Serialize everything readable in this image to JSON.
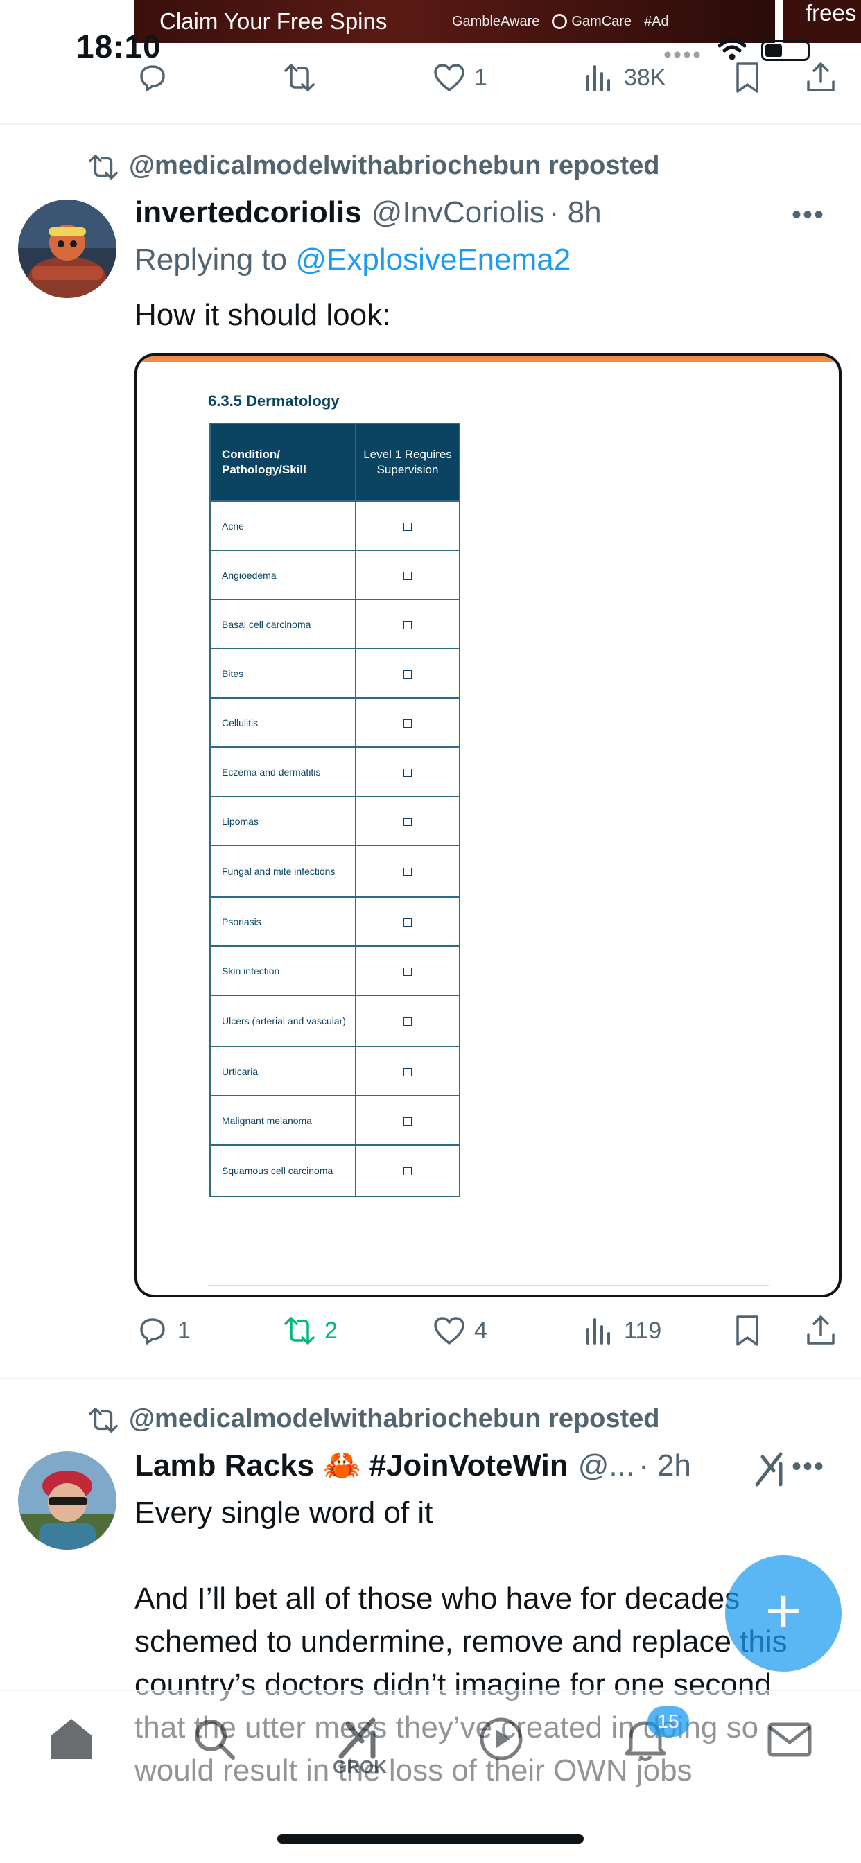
{
  "status_bar": {
    "time": "18:10"
  },
  "ad": {
    "claim": "Claim Your Free Spins",
    "gambleaware": "GambleAware",
    "gamcare": "GamCare",
    "ad_tag": "#Ad",
    "right_text": "frees"
  },
  "top_actions": {
    "replies": "",
    "reposts": "",
    "likes": "1",
    "views": "38K"
  },
  "tweet1": {
    "repost_text": "@medicalmodelwithabriochebun reposted",
    "name": "invertedcoriolis",
    "handle": "@InvCoriolis",
    "time": "· 8h",
    "reply_prefix": "Replying to ",
    "reply_handle": "@ExplosiveEnema2",
    "text": "How it should look:",
    "media": {
      "title": "6.3.5 Dermatology",
      "col1": "Condition/ Pathology/Skill",
      "col2": "Level 1 Requires Supervision",
      "rows": [
        "Acne",
        "Angioedema",
        "Basal cell carcinoma",
        "Bites",
        "Cellulitis",
        "Eczema and dermatitis",
        "Lipomas",
        "Fungal and mite infections",
        "Psoriasis",
        "Skin infection",
        "Ulcers (arterial and vascular)",
        "Urticaria",
        "Malignant melanoma",
        "Squamous cell carcinoma"
      ]
    },
    "actions": {
      "replies": "1",
      "reposts": "2",
      "likes": "4",
      "views": "119"
    }
  },
  "tweet2": {
    "repost_text": "@medicalmodelwithabriochebun reposted",
    "name": "Lamb Racks 🦀 #JoinVoteWin",
    "handle": "@...",
    "time": "· 2h",
    "text": "Every single word of it\n\nAnd I’ll bet all of those who have for decades schemed to undermine, remove and replace this country’s doctors didn’t imagine for one second that the utter mess they’ve created in doing so would result in the loss of their OWN jobs"
  },
  "navbar": {
    "grok_label": "GROK",
    "notifications_badge": "15"
  },
  "colors": {
    "accent": "#1d9bf0",
    "repost_green": "#00ba7c",
    "muted": "#536471",
    "table_header": "#0b4463"
  }
}
